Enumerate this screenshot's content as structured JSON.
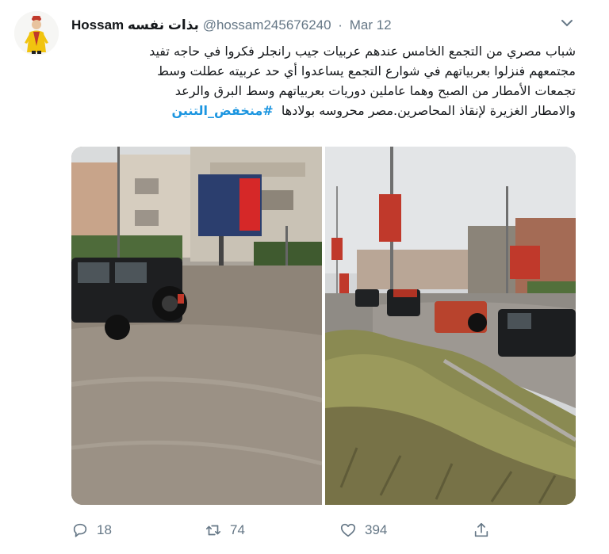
{
  "tweet": {
    "display_name": "Hossam بذات نفسه",
    "handle": "@hossam245676240",
    "separator": "·",
    "date": "Mar 12",
    "text_lines": [
      "شباب مصري من التجمع الخامس عندهم عربيات جيب رانجلر فكروا في حاجه تفيد",
      "مجتمعهم فنزلوا بعربياتهم في شوارع التجمع يساعدوا أي حد عربيته عطلت وسط",
      "تجمعات الأمطار من الصبح وهما عاملين دوريات بعربياتهم وسط البرق والرعد"
    ],
    "text_last_line": "والامطار الغزيرة لإنقاذ المحاصرين.مصر محروسه بولادها",
    "hashtag": "#منخفض_التنين",
    "counts": {
      "replies": "18",
      "retweets": "74",
      "likes": "394"
    }
  },
  "icons": {
    "avatar": "avatar-cartoon",
    "caret": "chevron-down-icon",
    "reply": "reply-icon",
    "retweet": "retweet-icon",
    "like": "heart-icon",
    "share": "share-icon"
  },
  "colors": {
    "name": "#14171a",
    "meta": "#657786",
    "hashtag": "#1b95e0"
  }
}
